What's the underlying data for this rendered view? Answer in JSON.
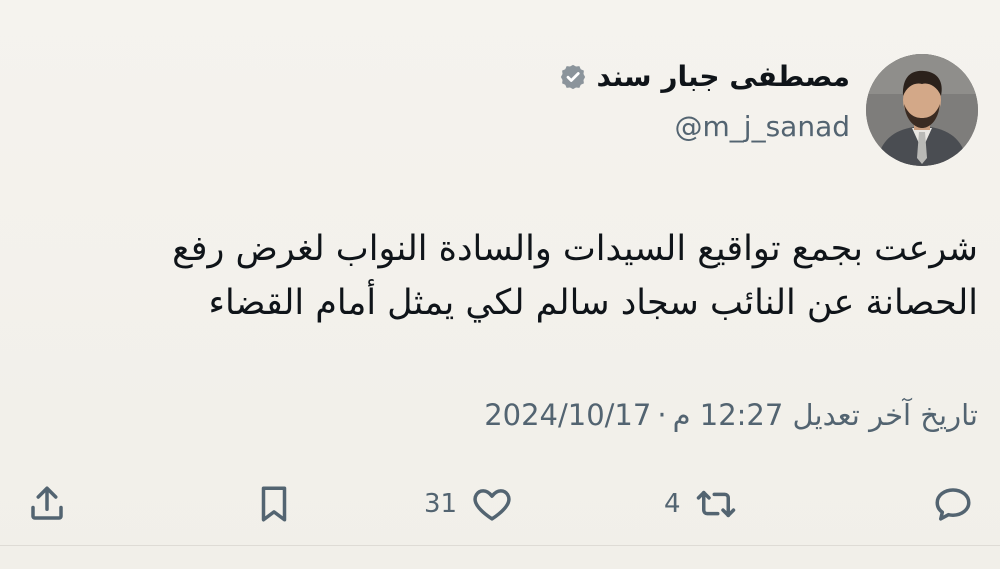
{
  "user": {
    "display_name": "مصطفى جبار سند",
    "handle": "@m_j_sanad",
    "verified_icon": "verified-badge-icon",
    "avatar": "profile-photo"
  },
  "tweet": {
    "lines": [
      "شرعت بجمع تواقيع السيدات والسادة النواب لغرض رفع",
      "الحصانة عن النائب سجاد سالم لكي يمثل أمام القضاء"
    ]
  },
  "meta": {
    "edited_label": "تاريخ آخر تعديل",
    "time": "12:27 م",
    "separator": "·",
    "date": "2024/10/17"
  },
  "actions": {
    "reply": {
      "icon": "reply-icon",
      "count": ""
    },
    "retweet": {
      "icon": "retweet-icon",
      "count": "4"
    },
    "like": {
      "icon": "heart-icon",
      "count": "31"
    },
    "bookmark": {
      "icon": "bookmark-icon",
      "count": ""
    },
    "share": {
      "icon": "share-icon",
      "count": ""
    }
  },
  "colors": {
    "background": "#f3f1ec",
    "text": "#0f1419",
    "secondary": "#536471"
  }
}
